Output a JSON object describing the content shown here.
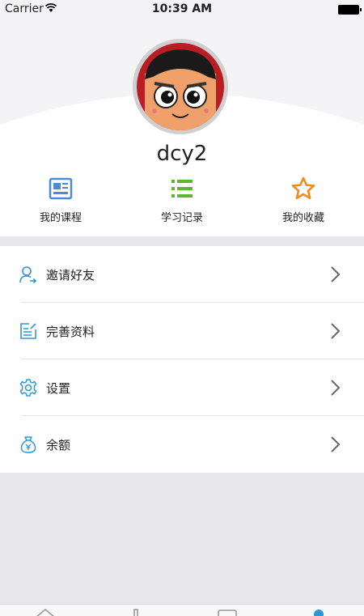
{
  "status_bar": {
    "carrier": "Carrier",
    "time": "10:39 AM"
  },
  "profile": {
    "username": "dcy2"
  },
  "quick_actions": [
    {
      "label": "我的课程",
      "icon": "course-icon",
      "color": "#4a8ad8"
    },
    {
      "label": "学习记录",
      "icon": "list-icon",
      "color": "#5cb82e"
    },
    {
      "label": "我的收藏",
      "icon": "star-icon",
      "color": "#ef8c1a"
    }
  ],
  "menu": [
    {
      "label": "邀请好友",
      "icon": "invite-user-icon"
    },
    {
      "label": "完善资料",
      "icon": "edit-profile-icon"
    },
    {
      "label": "设置",
      "icon": "gear-icon"
    },
    {
      "label": "余额",
      "icon": "money-bag-icon"
    }
  ],
  "colors": {
    "accent_blue": "#2f97d4",
    "page_bg": "#e8e8ec"
  }
}
